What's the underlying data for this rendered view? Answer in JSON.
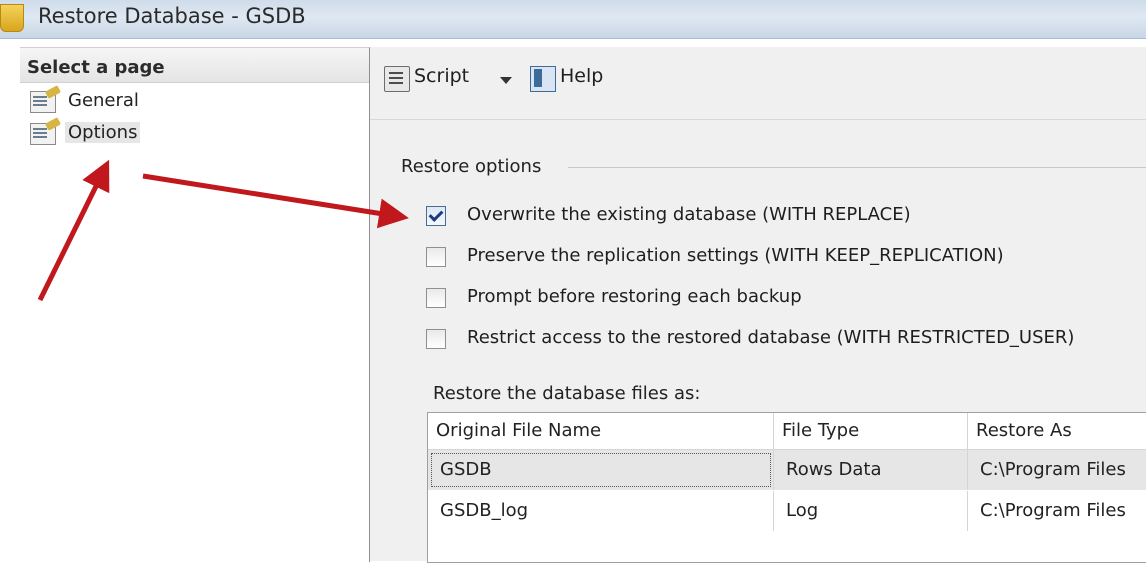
{
  "window": {
    "title": "Restore Database - GSDB"
  },
  "sidebar": {
    "header": "Select a page",
    "items": [
      {
        "label": "General",
        "icon": "properties-page-icon",
        "selected": false
      },
      {
        "label": "Options",
        "icon": "properties-page-icon",
        "selected": true
      }
    ]
  },
  "toolbar": {
    "script_label": "Script",
    "help_label": "Help"
  },
  "restore_options": {
    "group_label": "Restore options",
    "options": [
      {
        "label": "Overwrite the existing database (WITH REPLACE)",
        "checked": true
      },
      {
        "label": "Preserve the replication settings (WITH KEEP_REPLICATION)",
        "checked": false
      },
      {
        "label": "Prompt before restoring each backup",
        "checked": false
      },
      {
        "label": "Restrict access to the restored database (WITH RESTRICTED_USER)",
        "checked": false
      }
    ]
  },
  "files": {
    "label": "Restore the database files as:",
    "columns": [
      "Original File Name",
      "File Type",
      "Restore As"
    ],
    "rows": [
      [
        "GSDB",
        "Rows Data",
        "C:\\Program Files"
      ],
      [
        "GSDB_log",
        "Log",
        "C:\\Program Files"
      ]
    ]
  },
  "colors": {
    "annotation_arrow": "#c0181c",
    "panel_bg": "#f0f0f0",
    "titlebar_bg": "#d6e2ee"
  }
}
